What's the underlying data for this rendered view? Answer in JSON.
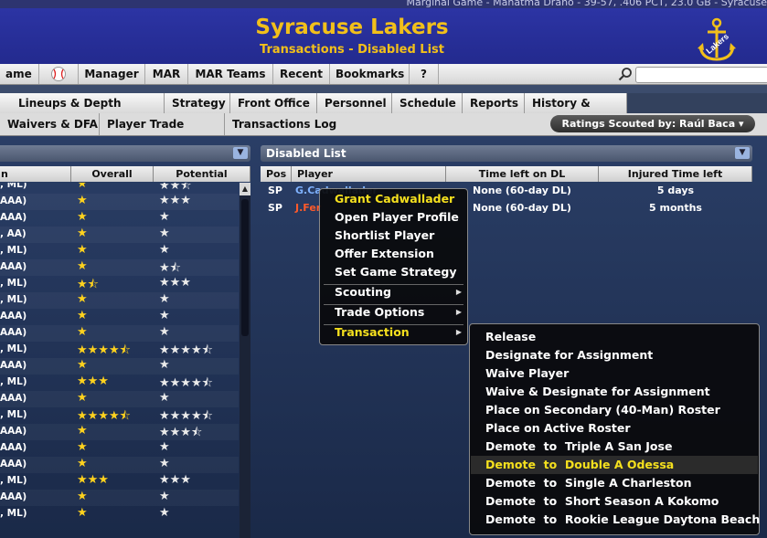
{
  "status_bar": {
    "text": "Marginal Game -  Mahatma Drano -  39-57, .406 PCT, 23.0 GB -  Syracuse"
  },
  "header": {
    "title": "Syracuse Lakers",
    "subtitle": "Transactions - Disabled List",
    "logo_text": "Lakers"
  },
  "menubar": {
    "items": [
      "ame",
      "",
      "Manager",
      "MAR",
      "MAR Teams",
      "Recent",
      "Bookmarks",
      "?"
    ],
    "baseball_icon": "baseball-icon",
    "search_icon": "search-icon"
  },
  "tabs": [
    "Lineups & Depth Charts",
    "Strategy",
    "Front Office",
    "Personnel",
    "Schedule",
    "Reports",
    "History & News"
  ],
  "subtabs": [
    "Waivers & DFA",
    "Player Trade Status",
    "Transactions Log"
  ],
  "ratings_button": "Ratings Scouted by: Raúl Baca ▾",
  "left_panel": {
    "columns": [
      "n",
      "Overall",
      "Potential"
    ],
    "rows": [
      {
        "level": ", ML)",
        "overall": 1,
        "potential": 2.5
      },
      {
        "level": "AAA)",
        "overall": 1,
        "potential": 3
      },
      {
        "level": "AAA)",
        "overall": 1,
        "potential": 1
      },
      {
        "level": ", AA)",
        "overall": 1,
        "potential": 1
      },
      {
        "level": ", ML)",
        "overall": 1,
        "potential": 1
      },
      {
        "level": "AAA)",
        "overall": 1,
        "potential": 1.5
      },
      {
        "level": ", ML)",
        "overall": 1.5,
        "potential": 3
      },
      {
        "level": ", ML)",
        "overall": 1,
        "potential": 1
      },
      {
        "level": "AAA)",
        "overall": 1,
        "potential": 1
      },
      {
        "level": "AAA)",
        "overall": 1,
        "potential": 1
      },
      {
        "level": ", ML)",
        "overall": 4.5,
        "potential": 4.5
      },
      {
        "level": "AAA)",
        "overall": 1,
        "potential": 1
      },
      {
        "level": ", ML)",
        "overall": 3,
        "potential": 4.5
      },
      {
        "level": "AAA)",
        "overall": 1,
        "potential": 1
      },
      {
        "level": ", ML)",
        "overall": 4.5,
        "potential": 4.5
      },
      {
        "level": "AAA)",
        "overall": 1,
        "potential": 3.5
      },
      {
        "level": "AAA)",
        "overall": 1,
        "potential": 1
      },
      {
        "level": "AAA)",
        "overall": 1,
        "potential": 1
      },
      {
        "level": ", ML)",
        "overall": 3,
        "potential": 3
      },
      {
        "level": "AAA)",
        "overall": 1,
        "potential": 1
      },
      {
        "level": ", ML)",
        "overall": 1,
        "potential": 1
      }
    ]
  },
  "right_panel": {
    "title": "Disabled List",
    "columns": [
      "Pos",
      "Player",
      "Time left on DL",
      "Injured Time left"
    ],
    "rows": [
      {
        "pos": "SP",
        "player": "G.Cadwallader",
        "time_left": "None (60-day DL)",
        "injured": "5 days"
      },
      {
        "pos": "SP",
        "player": "J.Fer",
        "time_left": "None (60-day DL)",
        "injured": "5 months"
      }
    ]
  },
  "context_menu": {
    "title": "Grant Cadwallader",
    "items": [
      "Open Player Profile",
      "Shortlist Player",
      "Offer Extension",
      "Set Game Strategy"
    ],
    "submenus": [
      "Scouting",
      "Trade Options",
      "Transaction"
    ]
  },
  "transaction_menu": {
    "items": [
      "Release",
      "Designate for Assignment",
      "Waive Player",
      "Waive & Designate for Assignment",
      "Place on Secondary (40-Man) Roster",
      "Place on Active Roster",
      "Demote  to  Triple A San Jose",
      "Demote  to  Double A Odessa",
      "Demote  to  Single A Charleston",
      "Demote  to  Short Season A Kokomo",
      "Demote  to  Rookie League Daytona Beach"
    ],
    "highlighted_index": 7
  },
  "colors": {
    "accent_gold": "#f2c01a",
    "header_blue": "#2c34a4",
    "highlight_yellow": "#f5e01e"
  }
}
